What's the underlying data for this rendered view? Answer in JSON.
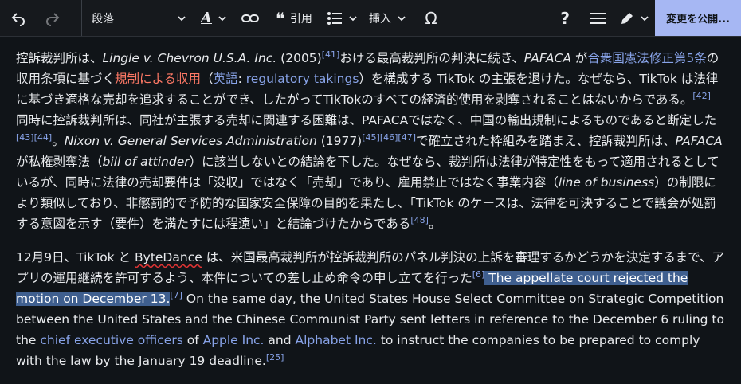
{
  "toolbar": {
    "paragraph_label": "段落",
    "cite_label": "引用",
    "insert_label": "挿入",
    "publish_label": "変更を公開..."
  },
  "paragraphs": {
    "p1": [
      {
        "t": "控訴裁判所は、"
      },
      {
        "t": "Lingle v. Chevron U.S.A. Inc.",
        "s": "em"
      },
      {
        "t": " (2005)"
      },
      {
        "t": "[41]",
        "s": "sup"
      },
      {
        "t": "おける最高裁判所の判決に続き、"
      },
      {
        "t": "PAFACA",
        "s": "em"
      },
      {
        "t": " が"
      },
      {
        "t": "合衆国憲法修正第5条",
        "s": "link"
      },
      {
        "t": "の収用条項に基づく"
      },
      {
        "t": "規制による収用",
        "s": "redlink"
      },
      {
        "t": "（"
      },
      {
        "t": "英語",
        "s": "link"
      },
      {
        "t": ": "
      },
      {
        "t": "regulatory takings",
        "s": "link"
      },
      {
        "t": "）を構成する TikTok の主張を退けた。なぜなら、TikTok は法律に基づき適格な売却を追求することができ、したがってTikTokのすべての経済的使用を剥奪されることはないからである。"
      },
      {
        "t": "[42]",
        "s": "sup"
      },
      {
        "t": " 同時に控訴裁判所は、同社が主張する売却に関連する困難は、PAFACAではなく、中国の輸出規制によるものであると断定した"
      },
      {
        "t": "[43]",
        "s": "sup"
      },
      {
        "t": "[44]",
        "s": "sup"
      },
      {
        "t": "。"
      },
      {
        "t": "Nixon v. General Services Administration",
        "s": "em"
      },
      {
        "t": " (1977)"
      },
      {
        "t": "[45]",
        "s": "sup"
      },
      {
        "t": "[46]",
        "s": "sup"
      },
      {
        "t": "[47]",
        "s": "sup"
      },
      {
        "t": "で確立された枠組みを踏まえ、控訴裁判所は、"
      },
      {
        "t": "PAFACA",
        "s": "em"
      },
      {
        "t": "が私権剥奪法（"
      },
      {
        "t": "bill of attinder",
        "s": "em"
      },
      {
        "t": "）に該当しないとの結論を下した。なぜなら、裁判所は法律が特定性をもって適用されるとしているが、同時に法律の売却要件は「没収」ではなく「売却」であり、雇用禁止ではなく事業内容（"
      },
      {
        "t": "line of business",
        "s": "em"
      },
      {
        "t": "）の制限により類似しており、非懲罰的で予防的な国家安全保障の目的を果たし、「TikTok のケースは、法律を可決することで議会が処罰する意図を示す（要件）を満たすには程遠い」と結論づけたからである"
      },
      {
        "t": "[48]",
        "s": "sup"
      },
      {
        "t": "。"
      }
    ],
    "p2": [
      {
        "t": "12月9日、TikTok と "
      },
      {
        "t": "ByteDance",
        "s": "ul"
      },
      {
        "t": " は、米国最高裁判所が控訴裁判所のパネル判決の上訴を審理するかどうかを決定するまで、アプリの運用継続を許可するよう、本件についての差し止め命令の申し立てを行った"
      },
      {
        "t": "[6]",
        "s": "sup"
      },
      {
        "t": " The appellate court rejected the motion on December 13.",
        "s": "hl"
      },
      {
        "t": "[7]",
        "s": "sup"
      },
      {
        "t": " On the same day, the United States House Select Committee on Strategic Competition between the United States and the Chinese Communist Party sent letters in reference to the December 6 ruling to the "
      },
      {
        "t": "chief executive officers",
        "s": "link"
      },
      {
        "t": " of "
      },
      {
        "t": "Apple Inc.",
        "s": "link"
      },
      {
        "t": " and "
      },
      {
        "t": "Alphabet Inc.",
        "s": "link"
      },
      {
        "t": " to instruct the companies to be prepared to comply with the law by the January 19 deadline."
      },
      {
        "t": "[25]",
        "s": "sup"
      }
    ]
  }
}
